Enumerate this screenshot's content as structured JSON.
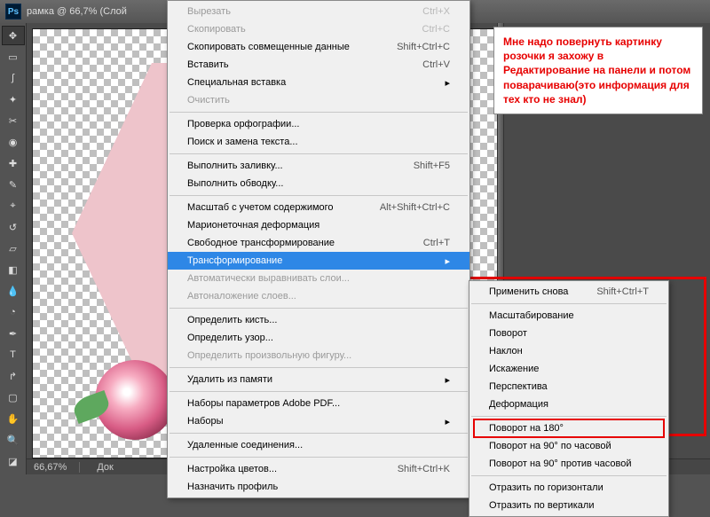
{
  "title": "рамка @ 66,7% (Слой",
  "zoom": "66,67%",
  "status_doc": "Док",
  "note_text": "Мне надо повернуть картинку розочки я захожу в Редактирование на панели и потом поварачиваю(это информация для тех кто не знал)",
  "win_close": "×",
  "menu": [
    {
      "label": "Вырезать",
      "shortcut": "Ctrl+X",
      "disabled": true
    },
    {
      "label": "Скопировать",
      "shortcut": "Ctrl+C",
      "disabled": true
    },
    {
      "label": "Скопировать совмещенные данные",
      "shortcut": "Shift+Ctrl+C"
    },
    {
      "label": "Вставить",
      "shortcut": "Ctrl+V"
    },
    {
      "label": "Специальная вставка",
      "arrow": true
    },
    {
      "label": "Очистить",
      "disabled": true
    },
    {
      "sep": true
    },
    {
      "label": "Проверка орфографии..."
    },
    {
      "label": "Поиск и замена текста..."
    },
    {
      "sep": true
    },
    {
      "label": "Выполнить заливку...",
      "shortcut": "Shift+F5"
    },
    {
      "label": "Выполнить обводку..."
    },
    {
      "sep": true
    },
    {
      "label": "Масштаб с учетом содержимого",
      "shortcut": "Alt+Shift+Ctrl+C"
    },
    {
      "label": "Марионеточная деформация"
    },
    {
      "label": "Свободное трансформирование",
      "shortcut": "Ctrl+T"
    },
    {
      "label": "Трансформирование",
      "arrow": true,
      "highlight": true
    },
    {
      "label": "Автоматически выравнивать слои...",
      "disabled": true
    },
    {
      "label": "Автоналожение слоев...",
      "disabled": true
    },
    {
      "sep": true
    },
    {
      "label": "Определить кисть..."
    },
    {
      "label": "Определить узор..."
    },
    {
      "label": "Определить произвольную фигуру...",
      "disabled": true
    },
    {
      "sep": true
    },
    {
      "label": "Удалить из памяти",
      "arrow": true
    },
    {
      "sep": true
    },
    {
      "label": "Наборы параметров Adobe PDF..."
    },
    {
      "label": "Наборы",
      "arrow": true
    },
    {
      "sep": true
    },
    {
      "label": "Удаленные соединения..."
    },
    {
      "sep": true
    },
    {
      "label": "Настройка цветов...",
      "shortcut": "Shift+Ctrl+K"
    },
    {
      "label": "Назначить профиль"
    }
  ],
  "submenu": [
    {
      "label": "Применить снова",
      "shortcut": "Shift+Ctrl+T"
    },
    {
      "sep": true
    },
    {
      "label": "Масштабирование"
    },
    {
      "label": "Поворот"
    },
    {
      "label": "Наклон"
    },
    {
      "label": "Искажение"
    },
    {
      "label": "Перспектива"
    },
    {
      "label": "Деформация"
    },
    {
      "sep": true
    },
    {
      "label": "Поворот на 180°"
    },
    {
      "label": "Поворот на 90° по часовой"
    },
    {
      "label": "Поворот на 90° против часовой"
    },
    {
      "sep": true
    },
    {
      "label": "Отразить по горизонтали"
    },
    {
      "label": "Отразить по вертикали"
    }
  ],
  "tools": [
    "move",
    "marquee",
    "lasso",
    "wand",
    "crop",
    "eyedrop",
    "heal",
    "brush",
    "stamp",
    "history",
    "eraser",
    "gradient",
    "blur",
    "dodge",
    "pen",
    "type",
    "path",
    "rect",
    "hand",
    "zoom",
    "fg-bg"
  ]
}
